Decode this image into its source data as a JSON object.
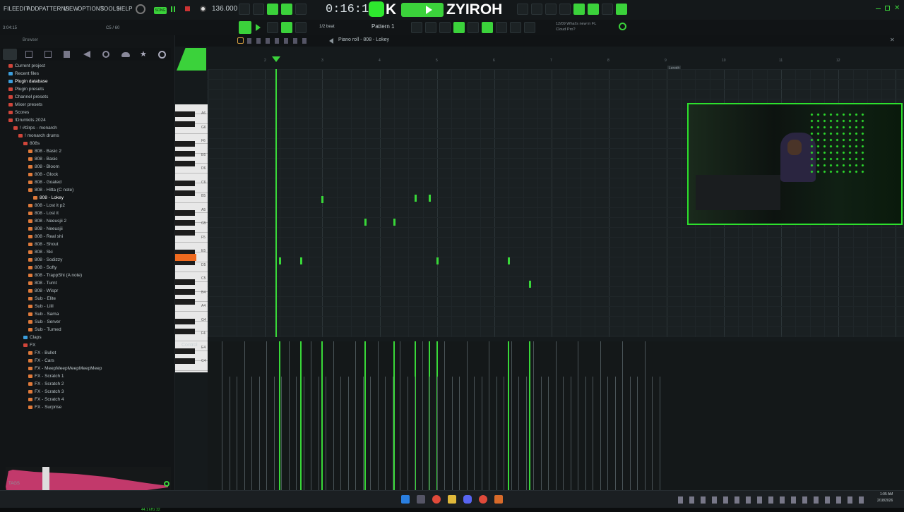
{
  "menu": [
    "FILE",
    "EDIT",
    "ADD",
    "PATTERNS",
    "VIEW",
    "OPTIONS",
    "TOOLS",
    "HELP"
  ],
  "transport": {
    "song_badge": "SONG",
    "tempo": "136.000",
    "time": "0:16:19",
    "sub_left": "3:04:15",
    "sub_mid": "C5 / 60"
  },
  "overlay": {
    "brand_text": "ZYIROH",
    "brand_initial": "K"
  },
  "toolbar": {
    "snap": "1/2 beat",
    "pattern": "Pattern 1",
    "news_line1": "12/09  What's new in FL",
    "news_line2": "Cloud Pro?"
  },
  "browser": {
    "title": "Browser",
    "items": [
      {
        "label": "Current project",
        "depth": 0,
        "color": "#d0453a"
      },
      {
        "label": "Recent files",
        "depth": 0,
        "color": "#3c9edc"
      },
      {
        "label": "Plugin database",
        "depth": 0,
        "color": "#3c9edc",
        "selected": true
      },
      {
        "label": "Plugin presets",
        "depth": 0,
        "color": "#d0453a"
      },
      {
        "label": "Channel presets",
        "depth": 0,
        "color": "#d0453a"
      },
      {
        "label": "Mixer presets",
        "depth": 0,
        "color": "#d0453a"
      },
      {
        "label": "Scores",
        "depth": 0,
        "color": "#d0453a"
      },
      {
        "label": "!Drumkits 2024",
        "depth": 0,
        "color": "#d0453a"
      },
      {
        "label": "! #t3rps - monarch",
        "depth": 1,
        "color": "#d0453a"
      },
      {
        "label": "! monarch drums",
        "depth": 2,
        "color": "#d0453a"
      },
      {
        "label": "808s",
        "depth": 3,
        "color": "#d0453a"
      },
      {
        "label": "808 - Basic 2",
        "depth": 4,
        "color": "#e07a3a"
      },
      {
        "label": "808 - Basic",
        "depth": 4,
        "color": "#e07a3a"
      },
      {
        "label": "808 - Bloom",
        "depth": 4,
        "color": "#e07a3a"
      },
      {
        "label": "808 - Glock",
        "depth": 4,
        "color": "#e07a3a"
      },
      {
        "label": "808 - Goated",
        "depth": 4,
        "color": "#e07a3a"
      },
      {
        "label": "808 - Hitta (C note)",
        "depth": 4,
        "color": "#e07a3a"
      },
      {
        "label": "808 - Lokey",
        "depth": 5,
        "color": "#e07a3a",
        "selected": true
      },
      {
        "label": "808 - Lost it p2",
        "depth": 4,
        "color": "#e07a3a"
      },
      {
        "label": "808 - Lost it",
        "depth": 4,
        "color": "#e07a3a"
      },
      {
        "label": "808 - Neeusjii 2",
        "depth": 4,
        "color": "#e07a3a"
      },
      {
        "label": "808 - Neeusjii",
        "depth": 4,
        "color": "#e07a3a"
      },
      {
        "label": "808 - Real shi",
        "depth": 4,
        "color": "#e07a3a"
      },
      {
        "label": "808 - Shout",
        "depth": 4,
        "color": "#e07a3a"
      },
      {
        "label": "808 - Ski",
        "depth": 4,
        "color": "#e07a3a"
      },
      {
        "label": "808 - Sodizzy",
        "depth": 4,
        "color": "#e07a3a"
      },
      {
        "label": "808 - Softy",
        "depth": 4,
        "color": "#e07a3a"
      },
      {
        "label": "808 - TrappShi (A note)",
        "depth": 4,
        "color": "#e07a3a"
      },
      {
        "label": "808 - Turnt",
        "depth": 4,
        "color": "#e07a3a"
      },
      {
        "label": "808 - Wispr",
        "depth": 4,
        "color": "#e07a3a"
      },
      {
        "label": "Sub - Elite",
        "depth": 4,
        "color": "#e07a3a"
      },
      {
        "label": "Sub - Lilil",
        "depth": 4,
        "color": "#e07a3a"
      },
      {
        "label": "Sub - Sama",
        "depth": 4,
        "color": "#e07a3a"
      },
      {
        "label": "Sub - Server",
        "depth": 4,
        "color": "#e07a3a"
      },
      {
        "label": "Sub - Turned",
        "depth": 4,
        "color": "#e07a3a"
      },
      {
        "label": "Claps",
        "depth": 3,
        "color": "#3c9edc"
      },
      {
        "label": "FX",
        "depth": 3,
        "color": "#d0453a"
      },
      {
        "label": "FX - Bullet",
        "depth": 4,
        "color": "#e07a3a"
      },
      {
        "label": "FX - Cars",
        "depth": 4,
        "color": "#e07a3a"
      },
      {
        "label": "FX - MeepMeepMeepMeepMeep",
        "depth": 4,
        "color": "#e07a3a"
      },
      {
        "label": "FX - Scratch 1",
        "depth": 4,
        "color": "#e07a3a"
      },
      {
        "label": "FX - Scratch 2",
        "depth": 4,
        "color": "#e07a3a"
      },
      {
        "label": "FX - Scratch 3",
        "depth": 4,
        "color": "#e07a3a"
      },
      {
        "label": "FX - Scratch 4",
        "depth": 4,
        "color": "#e07a3a"
      },
      {
        "label": "FX - Surprise",
        "depth": 4,
        "color": "#e07a3a"
      }
    ],
    "footer_tags": "TAGS",
    "sample_info": "44.1 kHz 32"
  },
  "pianoroll": {
    "title": "Piano roll - 808 - Lokey",
    "length_label": "Length",
    "control_label": "Control",
    "key_labels": [
      "A6",
      "G6",
      "F6",
      "E6",
      "D6",
      "C6",
      "B5",
      "A5",
      "G5",
      "F5",
      "E5",
      "D5",
      "C5",
      "B4",
      "A4",
      "G4",
      "F4",
      "E4",
      "C4"
    ],
    "bar_numbers": [
      "2",
      "3",
      "4",
      "5",
      "6",
      "7",
      "8",
      "9",
      "10",
      "11",
      "12"
    ],
    "accent_color": "#39d839",
    "highlight_key_color": "#ef6a1f"
  },
  "taskbar": {
    "clock_time": "1:05 AM",
    "clock_date": "2/18/2026"
  }
}
